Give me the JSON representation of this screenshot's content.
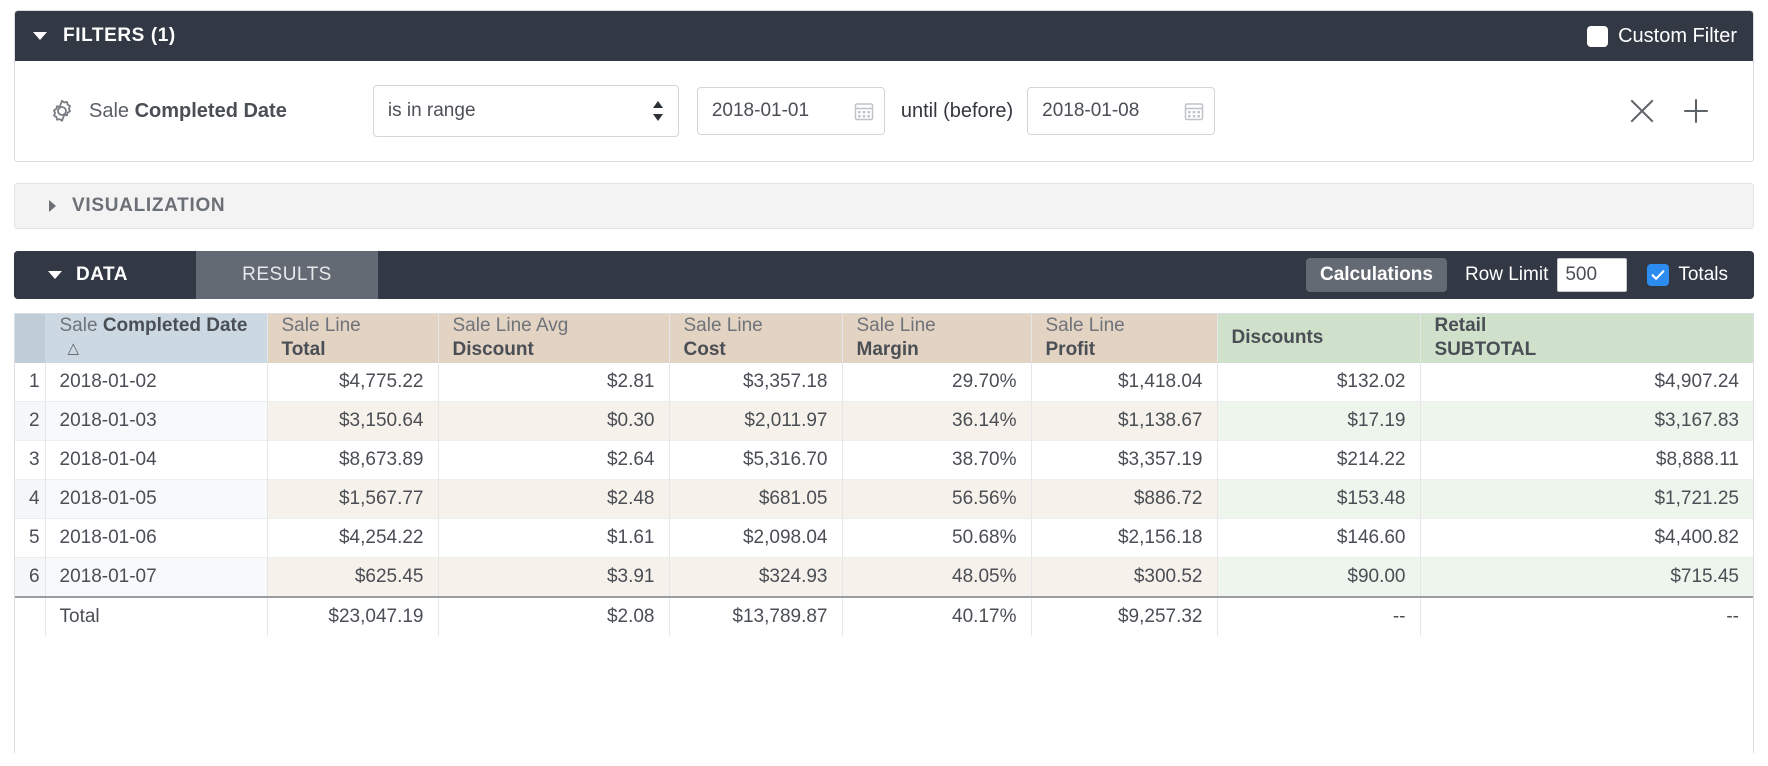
{
  "filters": {
    "title": "FILTERS (1)",
    "custom_filter_label": "Custom Filter",
    "custom_filter_checked": false,
    "field_prefix": "Sale ",
    "field_name": "Completed Date",
    "operator": "is in range",
    "date_from": "2018-01-01",
    "date_until_label": "until (before)",
    "date_to": "2018-01-08",
    "icons": {
      "collapse": "caret-down-icon",
      "field": "gear-icon",
      "calendar": "calendar-icon",
      "remove": "close-icon",
      "add": "plus-icon"
    }
  },
  "visualization": {
    "title": "VISUALIZATION",
    "expanded": false
  },
  "data_bar": {
    "tab_data": "DATA",
    "tab_results": "RESULTS",
    "calculations_label": "Calculations",
    "row_limit_label": "Row Limit",
    "row_limit_value": "500",
    "totals_label": "Totals",
    "totals_checked": true
  },
  "table": {
    "columns": [
      {
        "line1": "Sale ",
        "line2": "Completed Date",
        "group": "date",
        "sorted": true,
        "sort_dir": "asc"
      },
      {
        "line1": "Sale Line",
        "line2": "Total",
        "group": "tan",
        "sorted": false
      },
      {
        "line1": "Sale Line Avg",
        "line2": "Discount",
        "group": "tan",
        "sorted": false
      },
      {
        "line1": "Sale Line",
        "line2": "Cost",
        "group": "tan",
        "sorted": false
      },
      {
        "line1": "Sale Line",
        "line2": "Margin",
        "group": "tan",
        "sorted": false
      },
      {
        "line1": "Sale Line",
        "line2": "Profit",
        "group": "tan",
        "sorted": false
      },
      {
        "line1": "",
        "line2": "Discounts",
        "group": "green",
        "sorted": false
      },
      {
        "line1": "Retail",
        "line2": "SUBTOTAL",
        "group": "green",
        "sorted": false
      }
    ],
    "rows": [
      {
        "n": "1",
        "cells": [
          "2018-01-02",
          "$4,775.22",
          "$2.81",
          "$3,357.18",
          "29.70%",
          "$1,418.04",
          "$132.02",
          "$4,907.24"
        ]
      },
      {
        "n": "2",
        "cells": [
          "2018-01-03",
          "$3,150.64",
          "$0.30",
          "$2,011.97",
          "36.14%",
          "$1,138.67",
          "$17.19",
          "$3,167.83"
        ]
      },
      {
        "n": "3",
        "cells": [
          "2018-01-04",
          "$8,673.89",
          "$2.64",
          "$5,316.70",
          "38.70%",
          "$3,357.19",
          "$214.22",
          "$8,888.11"
        ]
      },
      {
        "n": "4",
        "cells": [
          "2018-01-05",
          "$1,567.77",
          "$2.48",
          "$681.05",
          "56.56%",
          "$886.72",
          "$153.48",
          "$1,721.25"
        ]
      },
      {
        "n": "5",
        "cells": [
          "2018-01-06",
          "$4,254.22",
          "$1.61",
          "$2,098.04",
          "50.68%",
          "$2,156.18",
          "$146.60",
          "$4,400.82"
        ]
      },
      {
        "n": "6",
        "cells": [
          "2018-01-07",
          "$625.45",
          "$3.91",
          "$324.93",
          "48.05%",
          "$300.52",
          "$90.00",
          "$715.45"
        ]
      }
    ],
    "total_row": {
      "label": "Total",
      "cells": [
        "$23,047.19",
        "$2.08",
        "$13,789.87",
        "40.17%",
        "$9,257.32",
        "--",
        "--"
      ]
    }
  },
  "colors": {
    "dark_bar": "#323844",
    "header_blue": "#ccd9e3",
    "header_tan": "#e3d3c2",
    "header_green": "#cfe1cb",
    "accent_blue": "#2d8cf0",
    "tab_inactive": "#646a74"
  }
}
